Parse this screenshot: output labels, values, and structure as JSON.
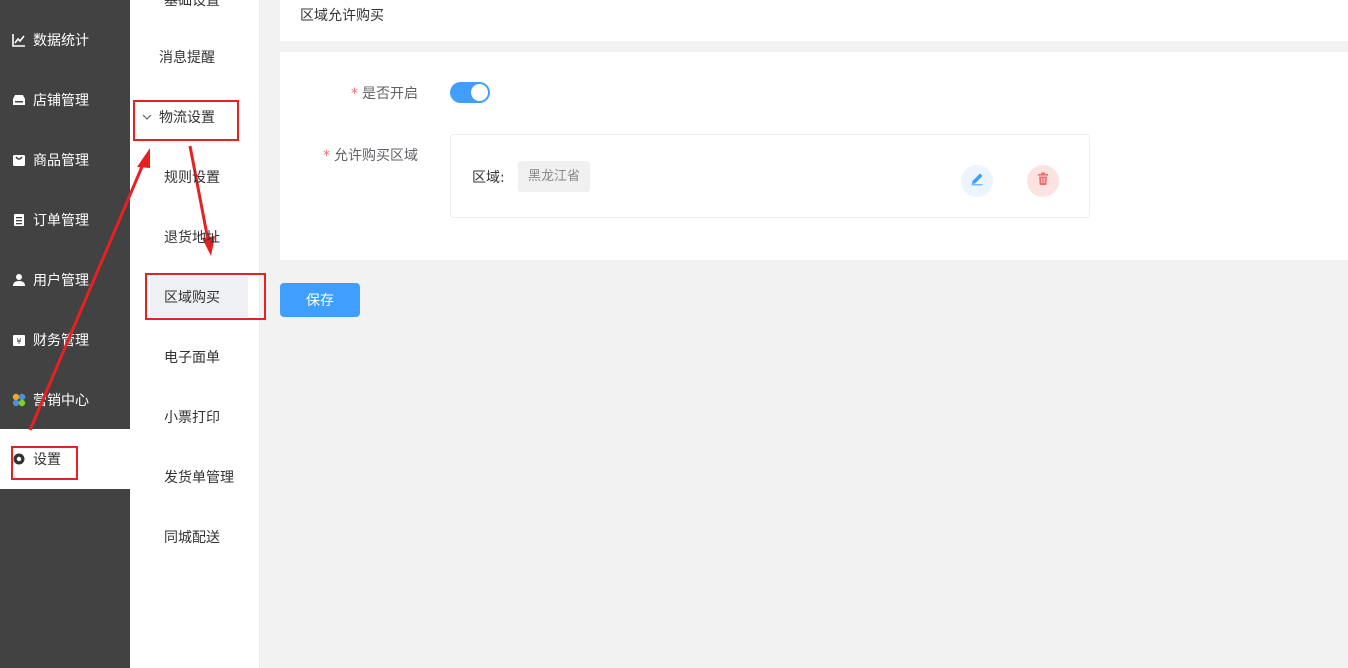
{
  "nav1": {
    "items": [
      {
        "label": "数据统计",
        "icon": "chart-line-icon"
      },
      {
        "label": "店铺管理",
        "icon": "store-icon"
      },
      {
        "label": "商品管理",
        "icon": "bag-icon"
      },
      {
        "label": "订单管理",
        "icon": "clipboard-icon"
      },
      {
        "label": "用户管理",
        "icon": "user-icon"
      },
      {
        "label": "财务管理",
        "icon": "finance-icon"
      },
      {
        "label": "营销中心",
        "icon": "marketing-icon"
      },
      {
        "label": "设置",
        "icon": "gear-icon"
      }
    ]
  },
  "nav2": {
    "top_partial": "基础设置",
    "items": [
      {
        "label": "消息提醒"
      },
      {
        "label": "物流设置"
      },
      {
        "label": "规则设置"
      },
      {
        "label": "退货地址"
      },
      {
        "label": "区域购买"
      },
      {
        "label": "电子面单"
      },
      {
        "label": "小票打印"
      },
      {
        "label": "发货单管理"
      },
      {
        "label": "同城配送"
      }
    ]
  },
  "header": {
    "title": "区域允许购买"
  },
  "form": {
    "enable_label": "是否开启",
    "enable_value": true,
    "region_label": "允许购买区域",
    "region_item_label": "区域:",
    "region_tag": "黑龙江省",
    "required_mark": "*"
  },
  "actions": {
    "save_label": "保存"
  },
  "colors": {
    "primary": "#409eff",
    "danger": "#f56c6c",
    "annotation": "#e62121",
    "sidebar": "#424242"
  }
}
